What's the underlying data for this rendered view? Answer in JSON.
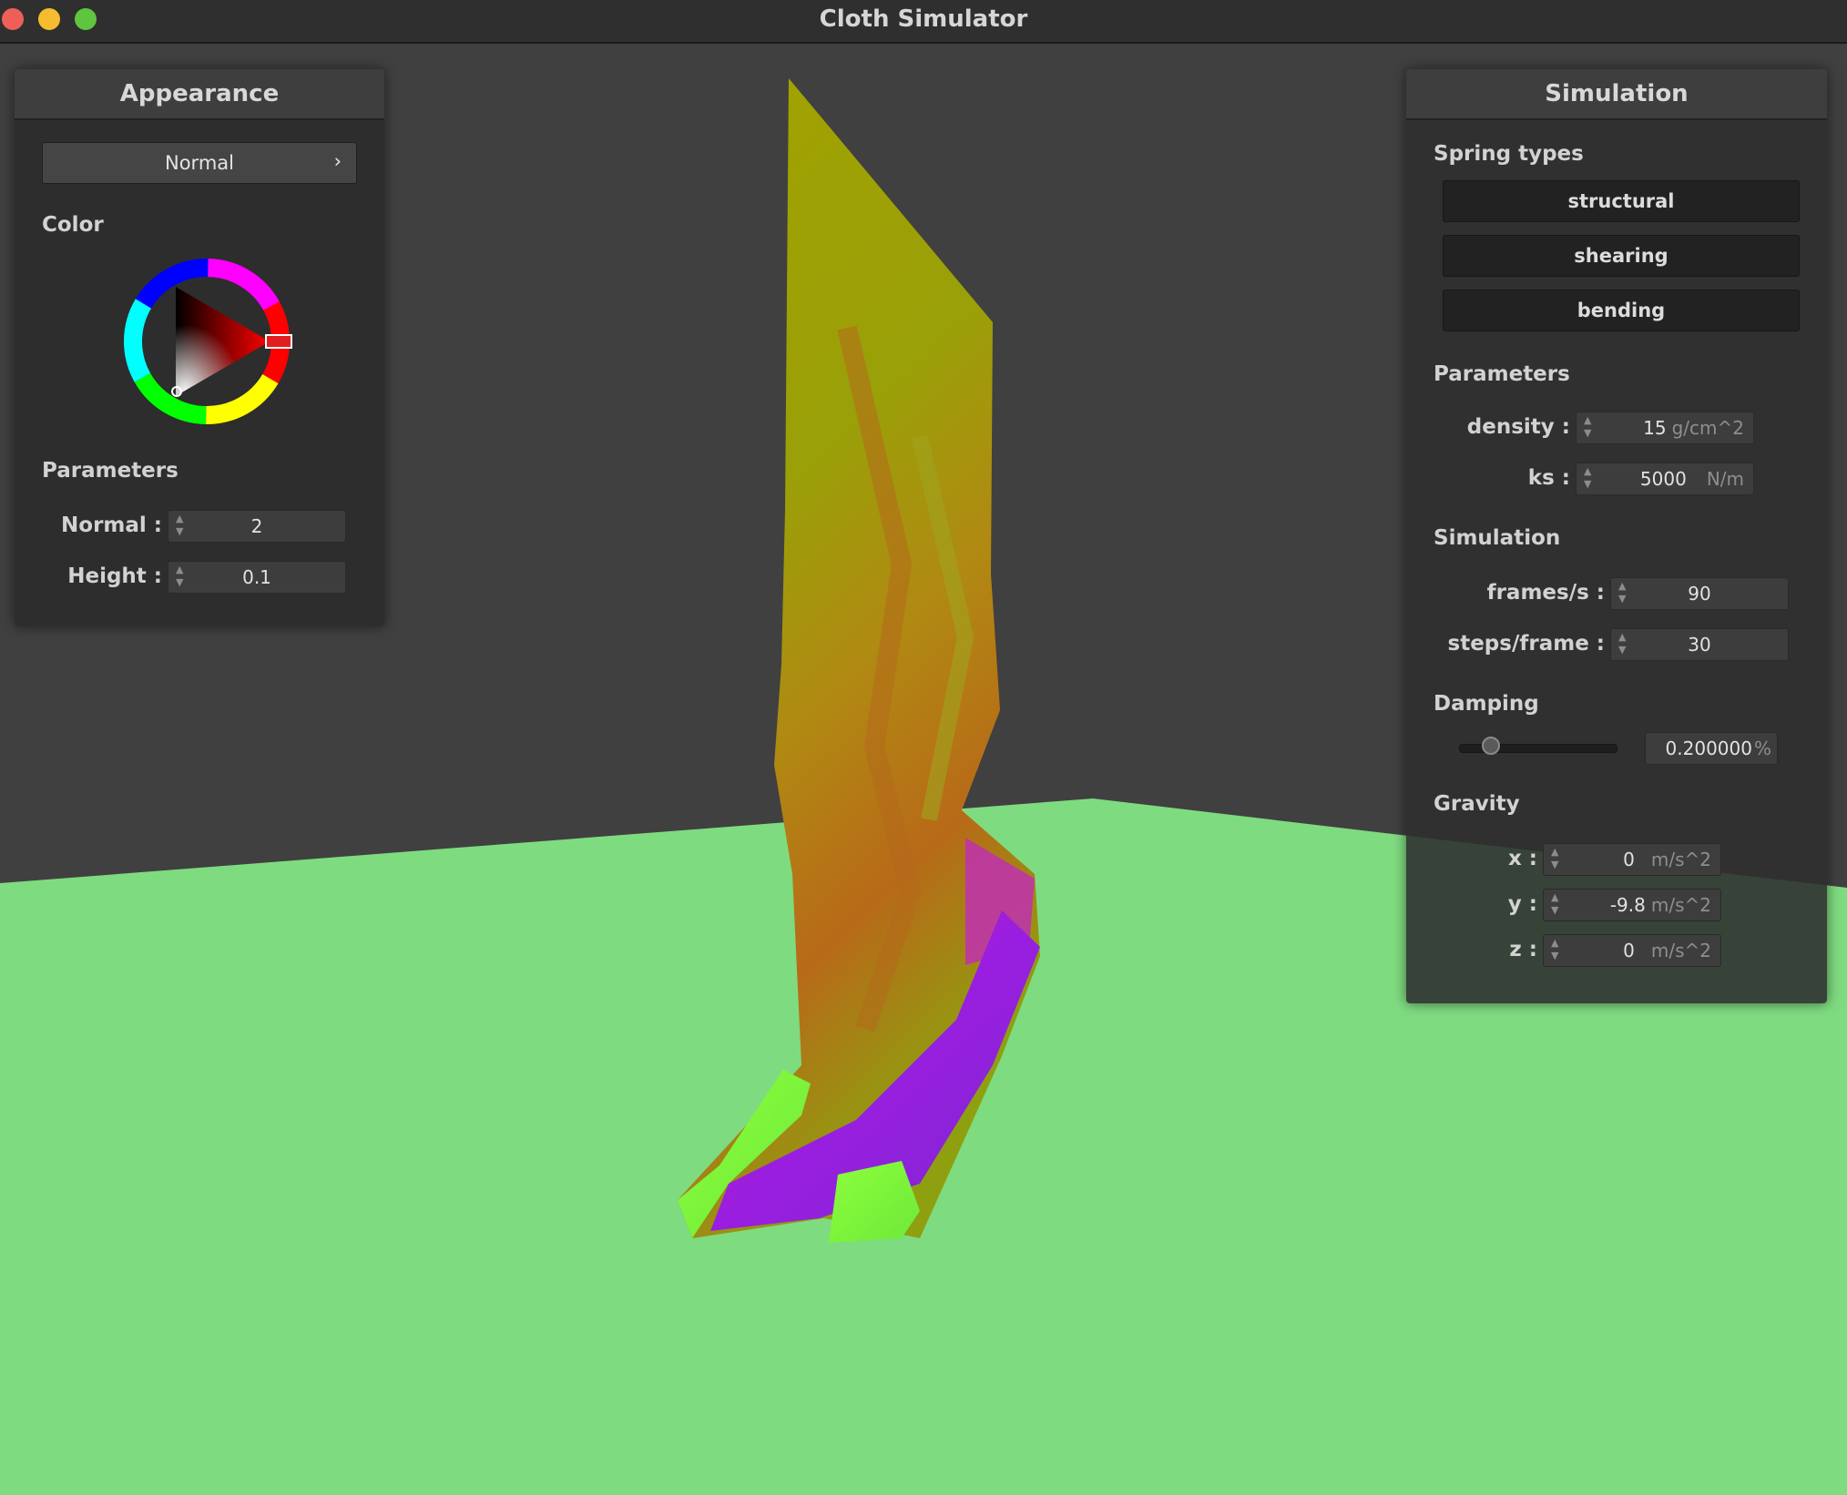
{
  "window": {
    "title": "Cloth Simulator"
  },
  "colors": {
    "ground": "#7fdb80",
    "background": "#404040",
    "panel": "#2d2d2d",
    "selected_color": "#ff0000"
  },
  "appearance": {
    "title": "Appearance",
    "shader_select": "Normal",
    "shader_chevron": "›",
    "color_label": "Color",
    "params_label": "Parameters",
    "normal_label": "Normal :",
    "normal_value": "2",
    "height_label": "Height :",
    "height_value": "0.1"
  },
  "simulation": {
    "title": "Simulation",
    "spring_types_label": "Spring types",
    "springs": [
      "structural",
      "shearing",
      "bending"
    ],
    "parameters_label": "Parameters",
    "density_label": "density :",
    "density_value": "15",
    "density_unit": "g/cm^2",
    "ks_label": "ks :",
    "ks_value": "5000",
    "ks_unit": "N/m",
    "sim_label": "Simulation",
    "fps_label": "frames/s :",
    "fps_value": "90",
    "steps_label": "steps/frame :",
    "steps_value": "30",
    "damping_label": "Damping",
    "damping_value": "0.200000",
    "damping_unit": "%",
    "damping_fraction": 0.2,
    "gravity_label": "Gravity",
    "gx_label": "x :",
    "gx_value": "0",
    "gy_label": "y :",
    "gy_value": "-9.8",
    "gz_label": "z :",
    "gz_value": "0",
    "gravity_unit": "m/s^2"
  }
}
